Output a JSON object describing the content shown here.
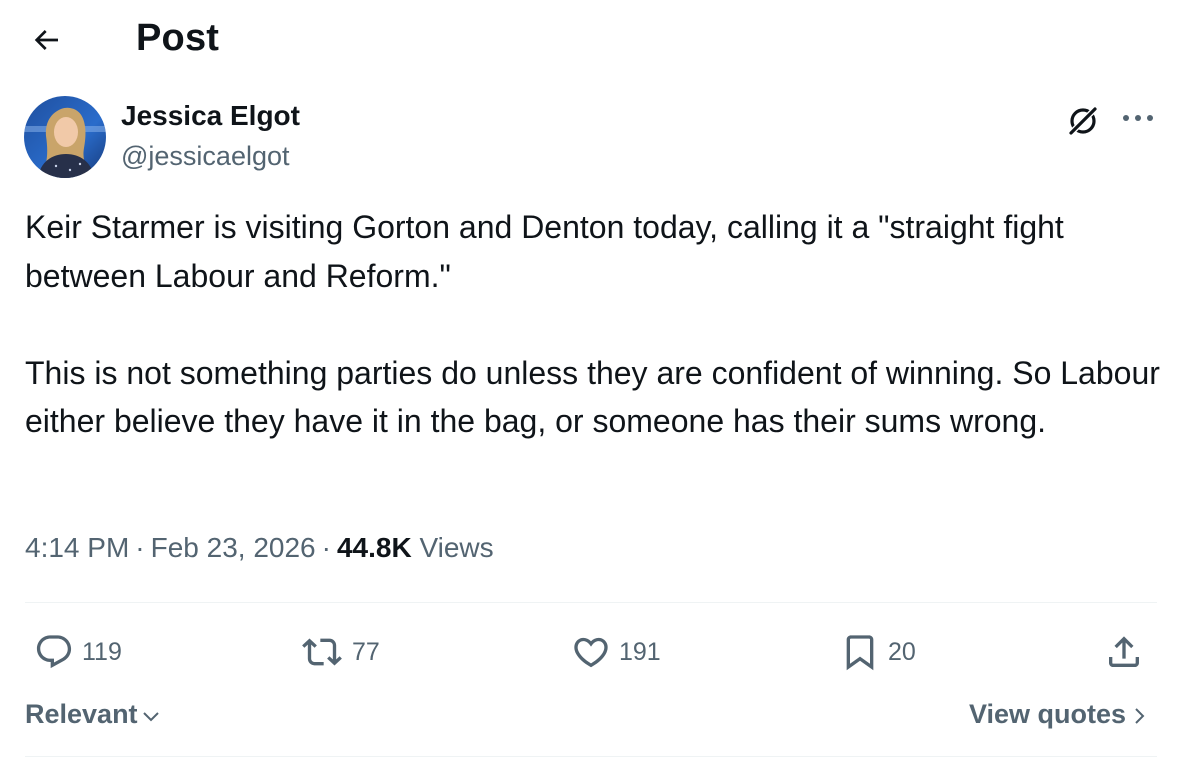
{
  "header": {
    "back_icon": "arrow-left-icon",
    "title": "Post"
  },
  "author": {
    "name": "Jessica Elgot",
    "handle": "@jessicaelgot",
    "avatar_icon": "avatar"
  },
  "actions_top": {
    "grok_icon": "grok-icon",
    "more_icon": "more-horizontal-icon"
  },
  "post": {
    "paragraph_1": "Keir Starmer is visiting Gorton and Denton today, calling it a \"straight fight between Labour and Reform.\"",
    "paragraph_2": "This is not something parties do unless they are confident of winning. So Labour either believe they have it in the bag, or someone has their sums wrong.",
    "time": "4:14 PM",
    "date": "Feb 23, 2026",
    "views_count": "44.8K",
    "views_label": "Views"
  },
  "stats": {
    "replies": "119",
    "reposts": "77",
    "likes": "191",
    "bookmarks": "20"
  },
  "footer": {
    "sort_label": "Relevant",
    "view_quotes_label": "View quotes"
  },
  "colors": {
    "text_primary": "#0f1419",
    "text_secondary": "#536471",
    "divider": "#eff3f4"
  }
}
